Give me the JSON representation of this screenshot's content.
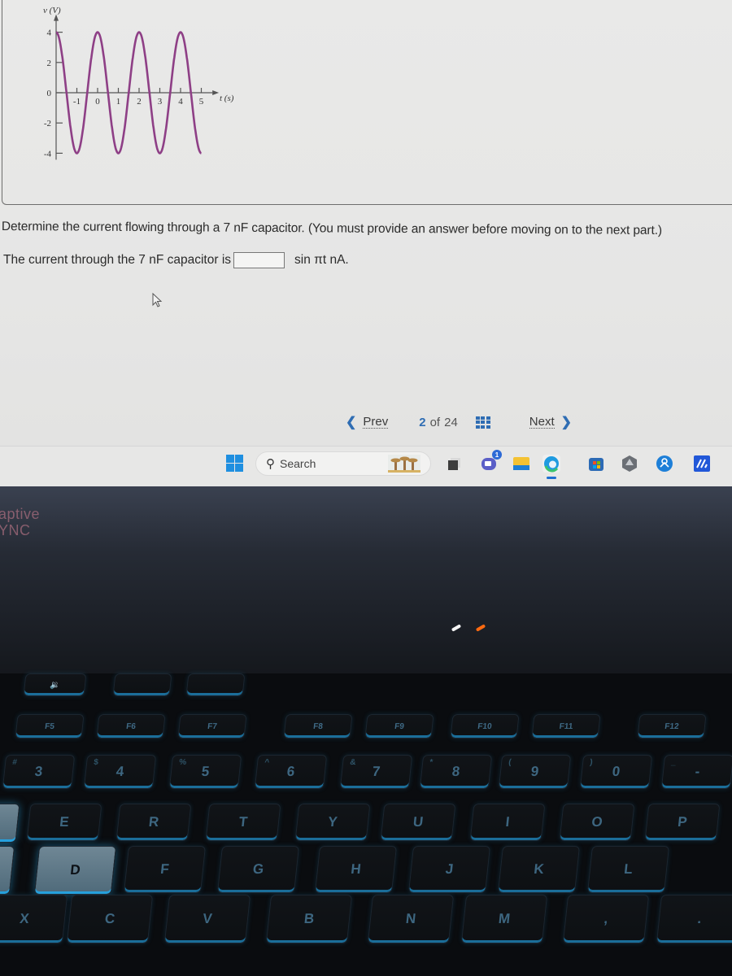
{
  "graph": {
    "y_axis_label": "v (V)",
    "x_axis_label": "t (s)",
    "y_ticks": [
      "4",
      "2",
      "0",
      "-2",
      "-4"
    ],
    "x_ticks": [
      "-1",
      "0",
      "1",
      "2",
      "3",
      "4",
      "5"
    ]
  },
  "chart_data": {
    "type": "line",
    "title": "",
    "xlabel": "t (s)",
    "ylabel": "v (V)",
    "function": "v(t) = 4 cos(pi t)",
    "amplitude": 4,
    "period": 2,
    "xlim": [
      -2,
      5.3
    ],
    "ylim": [
      -4,
      4
    ],
    "x_ticks": [
      -1,
      0,
      1,
      2,
      3,
      4,
      5
    ],
    "y_ticks": [
      -4,
      -2,
      0,
      2,
      4
    ],
    "series": [
      {
        "name": "v(t)",
        "color": "#8e3f86",
        "x": [
          -2,
          -1.5,
          -1,
          -0.5,
          0,
          0.5,
          1,
          1.5,
          2,
          2.5,
          3,
          3.5,
          4,
          4.5,
          5
        ],
        "y": [
          4,
          0,
          -4,
          0,
          4,
          0,
          -4,
          0,
          4,
          0,
          -4,
          0,
          4,
          0,
          -4
        ]
      }
    ],
    "grid": false,
    "legend": "none"
  },
  "question": {
    "prompt": "Determine the current flowing through a 7 nF capacitor. (You must provide an answer before moving on to the next part.)",
    "answer_prefix": "The current through the 7 nF capacitor is",
    "answer_value": "",
    "answer_suffix": "sin πt nA."
  },
  "navigation": {
    "prev_label": "Prev",
    "next_label": "Next",
    "current_page": "2",
    "of_label": "of",
    "total_pages": "24",
    "accent_color": "#2f6db3"
  },
  "taskbar": {
    "search_placeholder": "Search",
    "apps": [
      {
        "name": "task-view",
        "icon": "task-view-icon"
      },
      {
        "name": "teams-chat",
        "icon": "chat-icon",
        "badge": "1"
      },
      {
        "name": "file-explorer",
        "icon": "folder-icon"
      },
      {
        "name": "edge",
        "icon": "edge-browser-icon"
      },
      {
        "name": "microsoft-store",
        "icon": "store-icon"
      },
      {
        "name": "armoury-crate",
        "icon": "armoury-crate-icon"
      },
      {
        "name": "app-blue-circle",
        "icon": "app-circle-icon"
      },
      {
        "name": "myasus",
        "icon": "myasus-icon"
      }
    ]
  },
  "laptop": {
    "brand_line1": "aptive",
    "brand_line2": "YNC",
    "keys": {
      "row_fn": [
        "F5",
        "F6",
        "F7",
        "F8",
        "F9",
        "F10",
        "F11",
        "F12"
      ],
      "row_num": [
        "3",
        "4",
        "5",
        "6",
        "7",
        "8",
        "9",
        "0",
        "-"
      ],
      "row_num_sub": [
        "#",
        "$",
        "%",
        "^",
        "&",
        "*",
        "(",
        ")",
        "_"
      ],
      "row_top": [
        "E",
        "R",
        "T",
        "Y",
        "U",
        "I",
        "O",
        "P"
      ],
      "row_home": [
        "D",
        "F",
        "G",
        "H",
        "J",
        "K",
        "L"
      ],
      "row_bottom": [
        "X",
        "C",
        "V",
        "B",
        "N",
        "M"
      ]
    }
  }
}
